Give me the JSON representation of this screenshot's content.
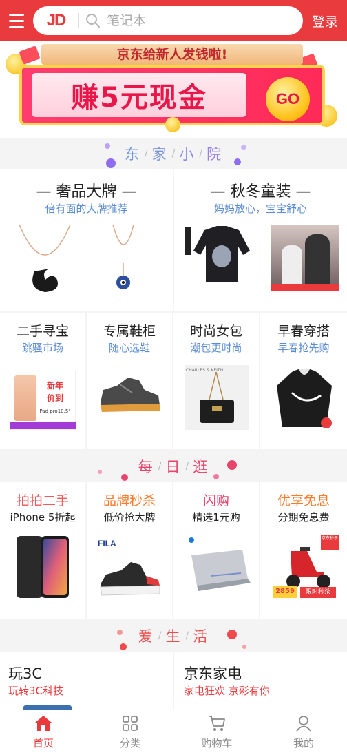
{
  "header": {
    "logo": "JD",
    "search_placeholder": "笔记本",
    "login_label": "登录"
  },
  "banner": {
    "ribbon": "京东给新人发钱啦!",
    "headline": "赚5元现金",
    "go": "GO"
  },
  "sections": {
    "s1": [
      "东",
      "家",
      "小",
      "院"
    ],
    "s2": [
      "每",
      "日",
      "逛"
    ],
    "s3": [
      "爱",
      "生",
      "活"
    ]
  },
  "big_cards": [
    {
      "title": "— 奢品大牌 —",
      "subtitle": "倍有面的大牌推荐"
    },
    {
      "title": "— 秋冬童装 —",
      "subtitle": "妈妈放心，宝宝舒心"
    }
  ],
  "small_cards": [
    {
      "title": "二手寻宝",
      "subtitle": "跳骚市场",
      "image_text_1": "新年",
      "image_text_2": "价到",
      "image_text_3": "iPad pro10.5\""
    },
    {
      "title": "专属鞋柜",
      "subtitle": "随心选鞋"
    },
    {
      "title": "时尚女包",
      "subtitle": "潮包更时尚",
      "image_text_1": "CHARLES & KEITH"
    },
    {
      "title": "早春穿搭",
      "subtitle": "早春抢先购"
    }
  ],
  "daily_cards": [
    {
      "title": "拍拍二手",
      "subtitle": "iPhone 5折起"
    },
    {
      "title": "品牌秒杀",
      "subtitle": "低价抢大牌",
      "image_text_1": "FILA"
    },
    {
      "title": "闪购",
      "subtitle": "精选1元购"
    },
    {
      "title": "优享免息",
      "subtitle": "分期免息费",
      "image_text_1": "京东秒杀",
      "image_text_2": "2859",
      "image_text_3": "限时秒杀"
    }
  ],
  "life_cards": [
    {
      "title": "玩3C",
      "subtitle": "玩转3C科技"
    },
    {
      "title": "京东家电",
      "subtitle": "家电狂欢 京彩有你"
    }
  ],
  "tabbar": [
    {
      "label": "首页",
      "icon": "home-icon"
    },
    {
      "label": "分类",
      "icon": "grid-icon"
    },
    {
      "label": "购物车",
      "icon": "cart-icon"
    },
    {
      "label": "我的",
      "icon": "user-icon"
    }
  ],
  "colors": {
    "brand": "#e93b3d",
    "subtitle_blue": "#5a8bd6",
    "section_blue": "#6f9ad6",
    "section_pink": "#e8456d",
    "section_red": "#ee4c4c"
  }
}
